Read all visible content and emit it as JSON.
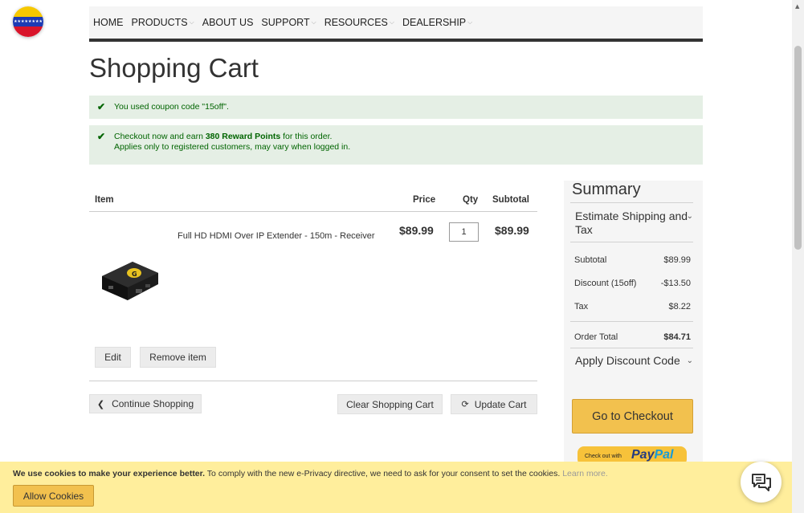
{
  "nav": {
    "items": [
      {
        "label": "HOME",
        "dropdown": false
      },
      {
        "label": "PRODUCTS",
        "dropdown": true
      },
      {
        "label": "ABOUT US",
        "dropdown": false
      },
      {
        "label": "SUPPORT",
        "dropdown": true
      },
      {
        "label": "RESOURCES",
        "dropdown": true
      },
      {
        "label": "DEALERSHIP",
        "dropdown": true
      }
    ]
  },
  "page_title": "Shopping Cart",
  "messages": {
    "coupon": "You used coupon code \"15off\".",
    "reward_prefix": "Checkout now and earn ",
    "reward_points": "380 Reward Points",
    "reward_suffix": " for this order.",
    "reward_note": "Applies only to registered customers, may vary when logged in."
  },
  "cart": {
    "headers": {
      "item": "Item",
      "price": "Price",
      "qty": "Qty",
      "subtotal": "Subtotal"
    },
    "items": [
      {
        "name": "Full HD HDMI Over IP Extender - 150m - Receiver",
        "price": "$89.99",
        "qty": "1",
        "subtotal": "$89.99"
      }
    ],
    "edit_label": "Edit",
    "remove_label": "Remove item",
    "continue_label": "Continue Shopping",
    "clear_label": "Clear Shopping Cart",
    "update_label": "Update Cart"
  },
  "summary": {
    "title": "Summary",
    "estimate_label": "Estimate Shipping and Tax",
    "rows": [
      {
        "label": "Subtotal",
        "value": "$89.99"
      },
      {
        "label": "Discount (15off)",
        "value": "-$13.50"
      },
      {
        "label": "Tax",
        "value": "$8.22"
      }
    ],
    "total_label": "Order Total",
    "total_value": "$84.71",
    "discount_label": "Apply Discount Code",
    "checkout_label": "Go to Checkout",
    "paypal_small": "Check out with",
    "paypal_pay": "Pay",
    "paypal_pal": "Pal"
  },
  "cookie": {
    "bold": "We use cookies to make your experience better.",
    "text": " To comply with the new e-Privacy directive, we need to ask for your consent to set the cookies. ",
    "learn": "Learn more.",
    "allow_label": "Allow Cookies"
  },
  "colors": {
    "accent": "#f2c14e",
    "success_bg": "#e5efe5",
    "success_text": "#006400",
    "cookie_bg": "#ffee9c"
  }
}
